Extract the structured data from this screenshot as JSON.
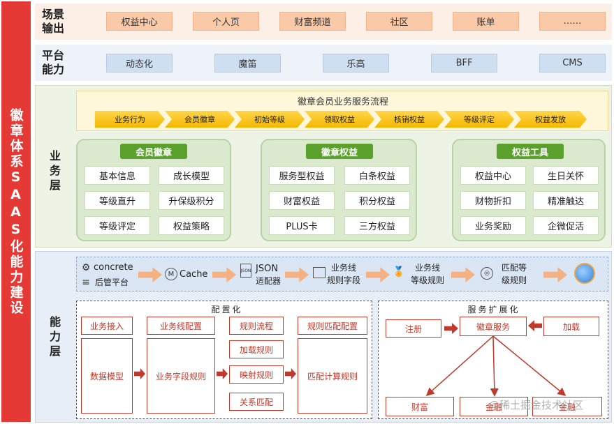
{
  "sidebar": {
    "label": "徽章体系SAAS化能力建设"
  },
  "scene_layer": {
    "title_line1": "场景",
    "title_line2": "输出",
    "items": [
      "权益中心",
      "个人页",
      "财富频道",
      "社区",
      "账单",
      "……"
    ]
  },
  "platform_layer": {
    "title_line1": "平台",
    "title_line2": "能力",
    "items": [
      "动态化",
      "魔笛",
      "乐高",
      "BFF",
      "CMS"
    ]
  },
  "business_layer": {
    "title": [
      "业",
      "务",
      "层"
    ],
    "flow_title": "徽章会员业务服务流程",
    "flow_steps": [
      "业务行为",
      "会员徽章",
      "初始等级",
      "领取权益",
      "核销权益",
      "等级评定",
      "权益发放"
    ],
    "groups": [
      {
        "title": "会员徽章",
        "cells": [
          "基本信息",
          "成长模型",
          "等级直升",
          "升保级积分",
          "等级评定",
          "权益策略"
        ]
      },
      {
        "title": "徽章权益",
        "cells": [
          "服务型权益",
          "白条权益",
          "财富权益",
          "积分权益",
          "PLUS卡",
          "三方权益"
        ]
      },
      {
        "title": "权益工具",
        "cells": [
          "权益中心",
          "生日关怀",
          "财物折扣",
          "精准触达",
          "业务奖励",
          "企微促活"
        ]
      }
    ]
  },
  "capability_layer": {
    "title": [
      "能",
      "力",
      "层"
    ],
    "pipeline": {
      "concrete": "concrete",
      "admin": "后管平台",
      "cache": "Cache",
      "json_line1": "JSON",
      "json_line2": "适配器",
      "biz_line1": "业务线",
      "biz_line2": "规则字段",
      "level_line1": "业务线",
      "level_line2": "等级规则",
      "match_line1": "匹配等",
      "match_line2": "级规则",
      "json_icon": "JSON"
    },
    "config": {
      "title": "配置化",
      "biz_access": "业务接入",
      "biz_config": "业务线配置",
      "rule_flow": "规则流程",
      "rule_match_config": "规则匹配配置",
      "data_model": "数据模型",
      "biz_field_rule": "业务字段规则",
      "load_rule": "加载规则",
      "map_rule": "映射规则",
      "match_calc_rule": "匹配计算规则",
      "relation_match": "关系匹配"
    },
    "service": {
      "title": "服务扩展化",
      "register": "注册",
      "badge_service": "徽章服务",
      "load": "加载",
      "wealth": "财富",
      "finance": "金融",
      "gold": "金融"
    }
  },
  "watermark": "@稀土掘金技术社区",
  "colors": {
    "sidebar_red": "#e53935",
    "scene_tag": "#f9c9a8",
    "platform_tag": "#cfdff2",
    "group_title_green": "#5aa02c",
    "flow_yellow": "#f5b800",
    "rule_red": "#c0392b",
    "arrow_orange": "#f4b183"
  }
}
